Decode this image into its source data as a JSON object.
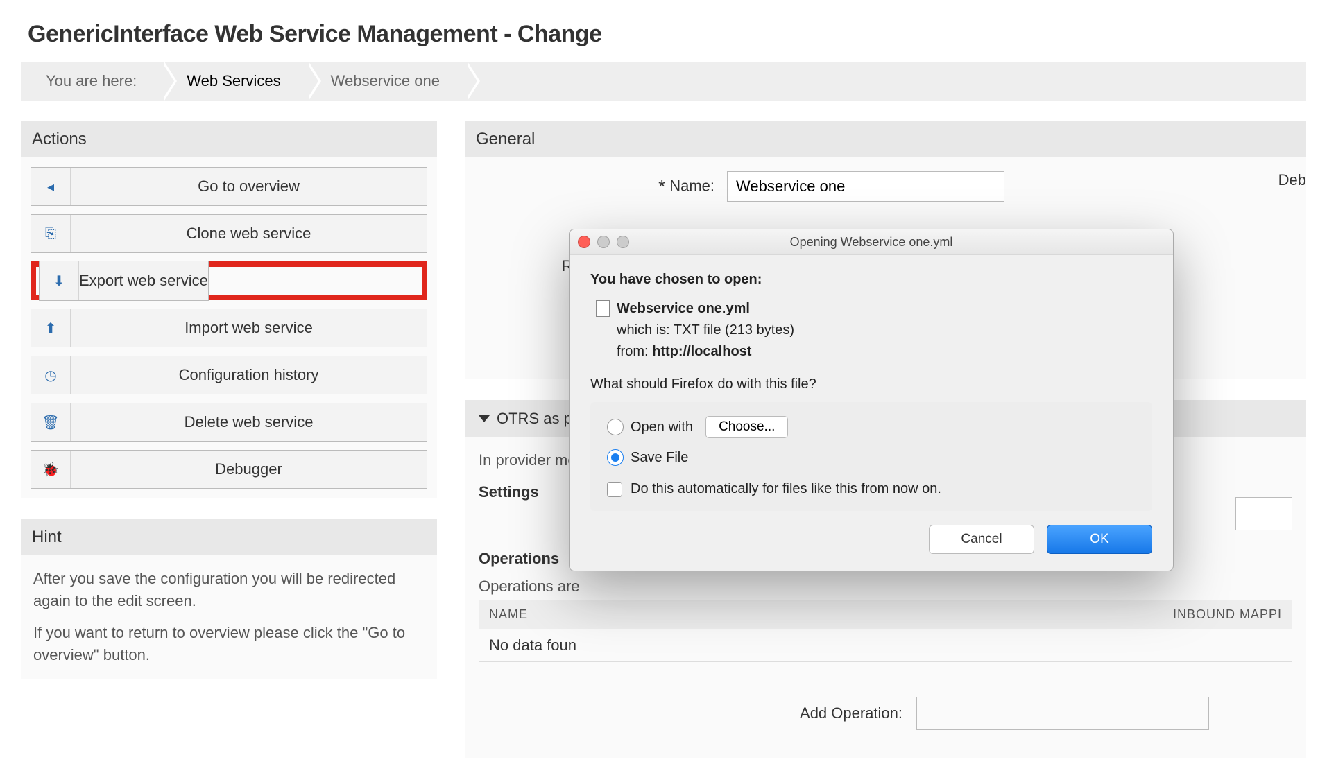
{
  "page_title": "GenericInterface Web Service Management - Change",
  "breadcrumb": {
    "here_label": "You are here:",
    "items": [
      "Web Services",
      "Webservice one"
    ]
  },
  "sidebar": {
    "actions_header": "Actions",
    "actions": [
      {
        "icon": "◂",
        "label": "Go to overview"
      },
      {
        "icon": "⎘",
        "label": "Clone web service"
      },
      {
        "icon": "⬇",
        "label": "Export web service",
        "highlight": true
      },
      {
        "icon": "⬆",
        "label": "Import web service"
      },
      {
        "icon": "◷",
        "label": "Configuration history"
      },
      {
        "icon": "🗑",
        "label": "Delete web service"
      },
      {
        "icon": "🐞",
        "label": "Debugger"
      }
    ],
    "hint_header": "Hint",
    "hint_1": "After you save the configuration you will be redirected again to the edit screen.",
    "hint_2": "If you want to return to overview please click the \"Go to overview\" button."
  },
  "main": {
    "general_header": "General",
    "name_label": "Name:",
    "name_value": "Webservice one",
    "remote_label_trunc": "Ren",
    "right_label_trunc": "Deb",
    "otrs_header": "OTRS as p",
    "provider_text": "In provider mo",
    "settings_head": "Settings",
    "operations_head": "Operations",
    "operations_sub": "Operations are",
    "table_col1": "NAME",
    "table_col2": "INBOUND MAPPI",
    "table_nodata": "No data foun",
    "add_op_label": "Add Operation:"
  },
  "dialog": {
    "title": "Opening Webservice one.yml",
    "chosen": "You have chosen to open:",
    "file_name": "Webservice one.yml",
    "which_label": "which is:",
    "which_value": "TXT file (213 bytes)",
    "from_label": "from:",
    "from_value": "http://localhost",
    "prompt": "What should Firefox do with this file?",
    "open_with": "Open with",
    "choose": "Choose...",
    "save_file": "Save File",
    "auto_checkbox": "Do this automatically for files like this from now on.",
    "cancel": "Cancel",
    "ok": "OK"
  }
}
